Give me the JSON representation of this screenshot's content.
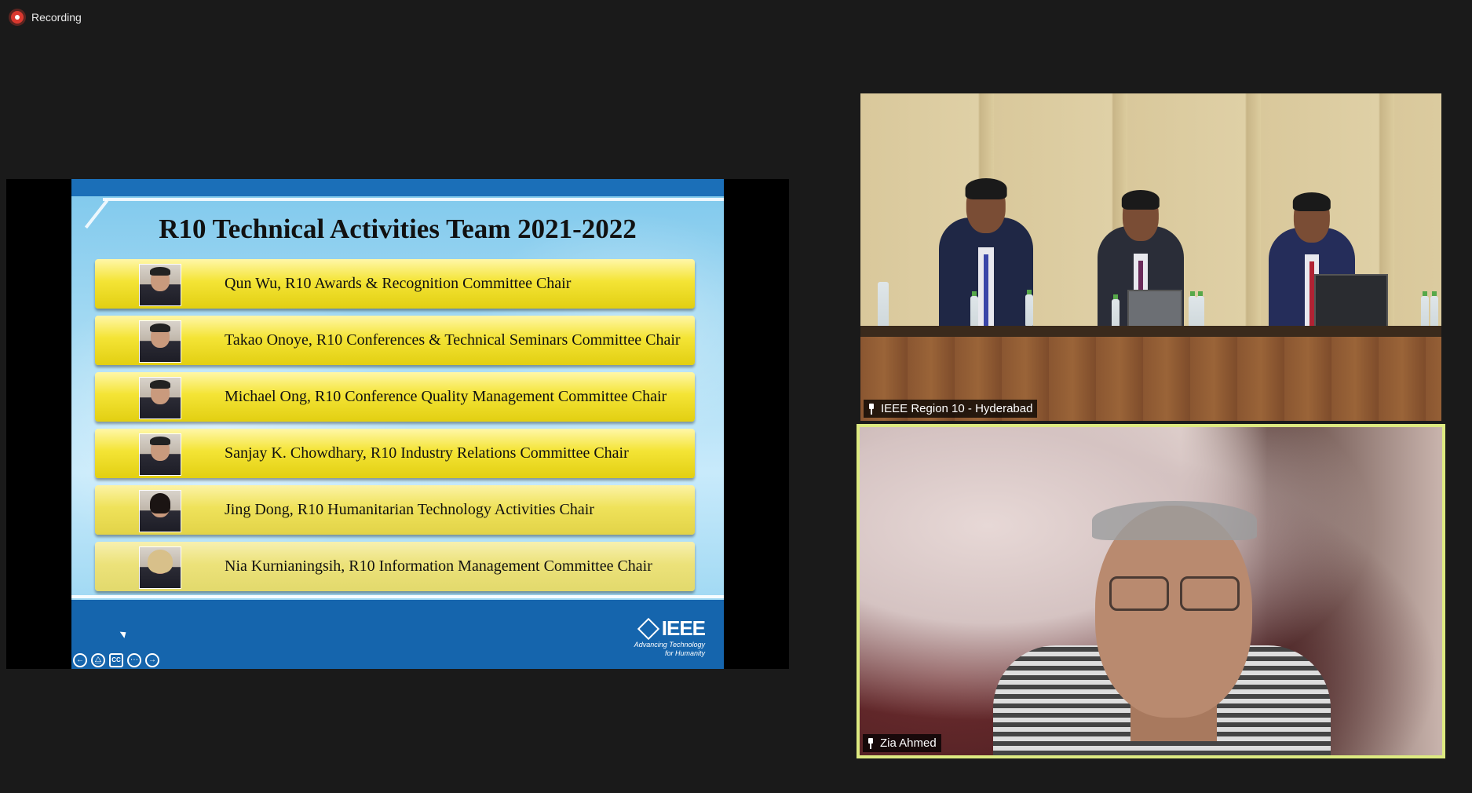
{
  "recording": {
    "label": "Recording"
  },
  "slide": {
    "title": "R10 Technical Activities Team 2021-2022",
    "members": [
      {
        "name": "Qun Wu, R10 Awards & Recognition Committee Chair"
      },
      {
        "name": "Takao Onoye, R10 Conferences & Technical Seminars Committee Chair"
      },
      {
        "name": "Michael Ong, R10 Conference Quality Management Committee Chair"
      },
      {
        "name": "Sanjay K. Chowdhary, R10 Industry Relations Committee Chair"
      },
      {
        "name": "Jing Dong, R10 Humanitarian Technology Activities Chair"
      },
      {
        "name": "Nia Kurnianingsih, R10 Information Management Committee Chair"
      }
    ],
    "logo": {
      "wordmark": "IEEE",
      "tagline_line1": "Advancing Technology",
      "tagline_line2": "for Humanity"
    },
    "controls": {
      "prev": "←",
      "pen": "⧋",
      "cc": "CC",
      "more": "⋯",
      "next": "→"
    }
  },
  "participants": [
    {
      "name": "IEEE Region 10 - Hyderabad",
      "pinned": true
    },
    {
      "name": "Zia Ahmed",
      "pinned": true,
      "active_speaker": true
    }
  ],
  "colors": {
    "active_speaker_border": "#ddea81",
    "recording": "#d9382f",
    "slide_band": "#1565ad"
  }
}
